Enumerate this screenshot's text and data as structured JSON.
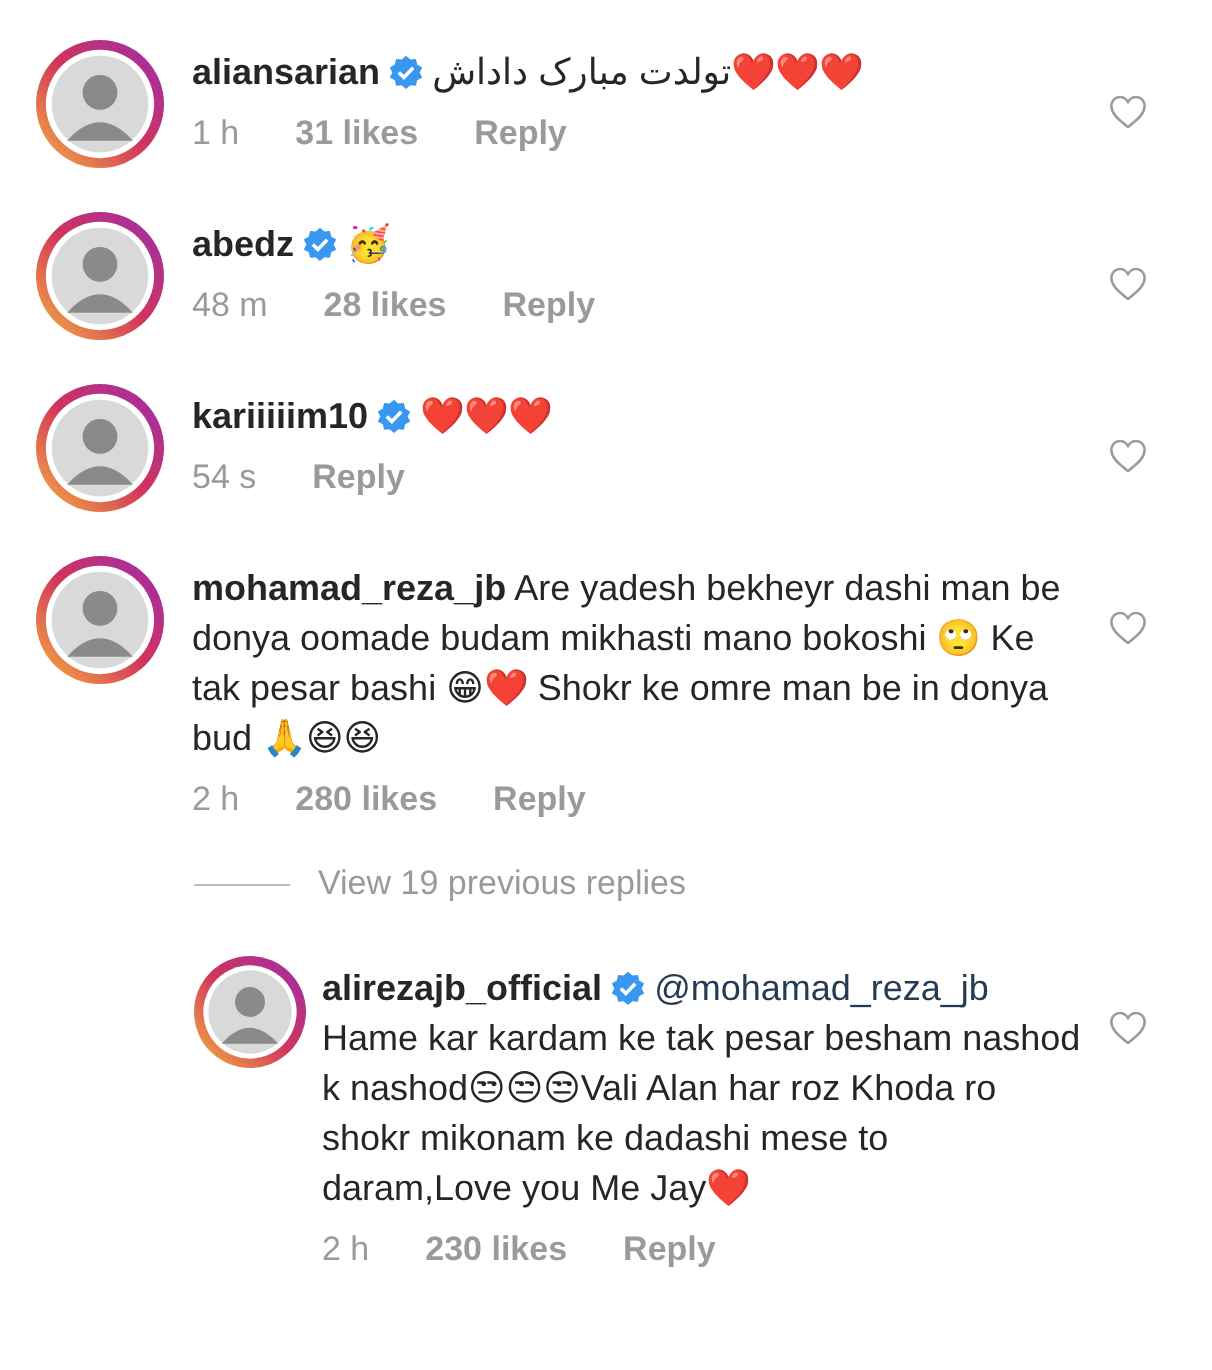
{
  "comments": [
    {
      "username": "aliansarian",
      "verified": true,
      "text": "تولدت مبارک داداش❤️❤️❤️",
      "time": "1 h",
      "likes": "31 likes",
      "reply": "Reply"
    },
    {
      "username": "abedz",
      "verified": true,
      "text": "🥳",
      "time": "48 m",
      "likes": "28 likes",
      "reply": "Reply"
    },
    {
      "username": "kariiiiim10",
      "verified": true,
      "text": "❤️❤️❤️",
      "time": "54 s",
      "reply": "Reply"
    },
    {
      "username": "mohamad_reza_jb",
      "verified": false,
      "text": "Are yadesh bekheyr dashi man be donya oomade budam mikhasti mano bokoshi 🙄 Ke tak pesar bashi 😁❤️ Shokr ke omre man be in donya bud 🙏😆😆",
      "time": "2 h",
      "likes": "280 likes",
      "reply": "Reply",
      "view_replies": "View 19 previous replies",
      "children": [
        {
          "username": "alirezajb_official",
          "verified": true,
          "mention": "@mohamad_reza_jb",
          "text": "Hame kar kardam ke tak pesar besham nashod k nashod😒😒😒Vali Alan har roz Khoda ro shokr mikonam ke dadashi mese to daram,Love you Me Jay❤️",
          "time": "2 h",
          "likes": "230 likes",
          "reply": "Reply"
        }
      ]
    }
  ]
}
